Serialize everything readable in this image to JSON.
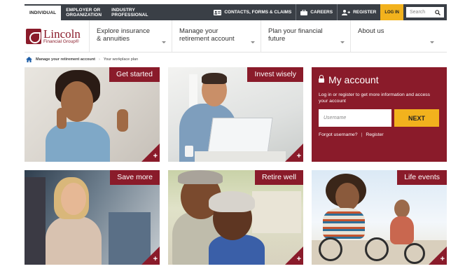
{
  "topbar": {
    "tabs": [
      {
        "line1": "INDIVIDUAL",
        "line2": ""
      },
      {
        "line1": "EMPLOYER OR",
        "line2": "ORGANIZATION"
      },
      {
        "line1": "INDUSTRY",
        "line2": "PROFESSIONAL"
      }
    ],
    "contacts_label": "CONTACTS, FORMS & CLAIMS",
    "careers_label": "CAREERS",
    "register_label": "REGISTER",
    "login_label": "LOG IN",
    "search_placeholder": "Search"
  },
  "logo": {
    "name": "Lincoln",
    "sub": "Financial Group®"
  },
  "nav": {
    "items": [
      {
        "line1": "Explore insurance",
        "line2": "& annuities"
      },
      {
        "line1": "Manage your",
        "line2": "retirement account"
      },
      {
        "line1": "Plan your financial",
        "line2": "future"
      },
      {
        "line1": "About us",
        "line2": ""
      }
    ]
  },
  "breadcrumb": {
    "parent": "Manage your retirement account",
    "current": "Your workplace plan"
  },
  "tiles": {
    "get_started": "Get started",
    "invest_wisely": "Invest wisely",
    "save_more": "Save more",
    "retire_well": "Retire well",
    "life_events": "Life events",
    "plus": "+"
  },
  "account": {
    "title": "My account",
    "description": "Log in or register to get more information and access your account",
    "username_placeholder": "Username",
    "next_label": "NEXT",
    "forgot_label": "Forgot username?",
    "separator": "|",
    "register_label": "Register"
  },
  "colors": {
    "brand": "#8a1b2a",
    "accent": "#f2b21d",
    "topbar": "#3a3f46"
  },
  "icons": [
    "home-icon",
    "contact-card-icon",
    "briefcase-icon",
    "add-user-icon",
    "search-icon",
    "lock-icon",
    "chevron-down-icon",
    "plus-icon"
  ]
}
